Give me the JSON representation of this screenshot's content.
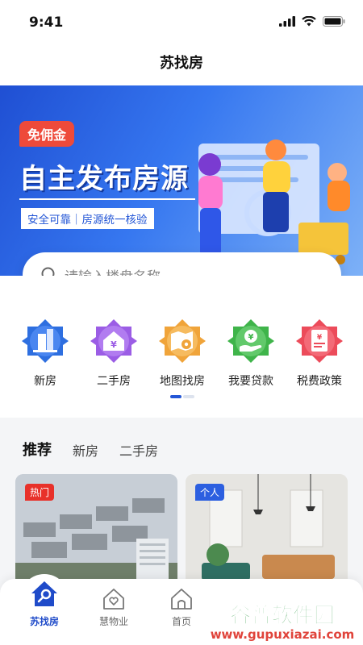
{
  "status_bar": {
    "time": "9:41"
  },
  "nav": {
    "title": "苏找房"
  },
  "banner": {
    "badge": "免佣金",
    "title": "自主发布房源",
    "subtitle": "安全可靠｜房源统一核验"
  },
  "search": {
    "placeholder": "请输入楼盘名称"
  },
  "quick_links": [
    {
      "label": "新房",
      "icon": "building-icon",
      "color": "#2e6fe0"
    },
    {
      "label": "二手房",
      "icon": "house-yen-icon",
      "color": "#9b5de5"
    },
    {
      "label": "地图找房",
      "icon": "map-pin-icon",
      "color": "#f0a43a"
    },
    {
      "label": "我要贷款",
      "icon": "hand-coin-icon",
      "color": "#3fb44a"
    },
    {
      "label": "税费政策",
      "icon": "tax-document-icon",
      "color": "#ec4b5a"
    }
  ],
  "feed": {
    "tabs": [
      {
        "label": "推荐",
        "active": true
      },
      {
        "label": "新房",
        "active": false
      },
      {
        "label": "二手房",
        "active": false
      }
    ],
    "cards": [
      {
        "tag": "热门",
        "image": "apartment-complex-photo"
      },
      {
        "tag": "个人",
        "image": "living-room-photo"
      }
    ]
  },
  "tabbar": {
    "items": [
      {
        "label": "苏找房",
        "icon": "house-key-icon",
        "active": true
      },
      {
        "label": "慧物业",
        "icon": "house-heart-icon",
        "active": false
      },
      {
        "label": "首页",
        "icon": "home-icon",
        "active": false
      }
    ]
  },
  "watermark": {
    "text": "谷普软件园",
    "url": "www.gupuxiazai.com"
  },
  "colors": {
    "brand_blue": "#1f4bc9",
    "badge_red": "#ee4a3a",
    "tag_blue": "#2c5fe0"
  }
}
